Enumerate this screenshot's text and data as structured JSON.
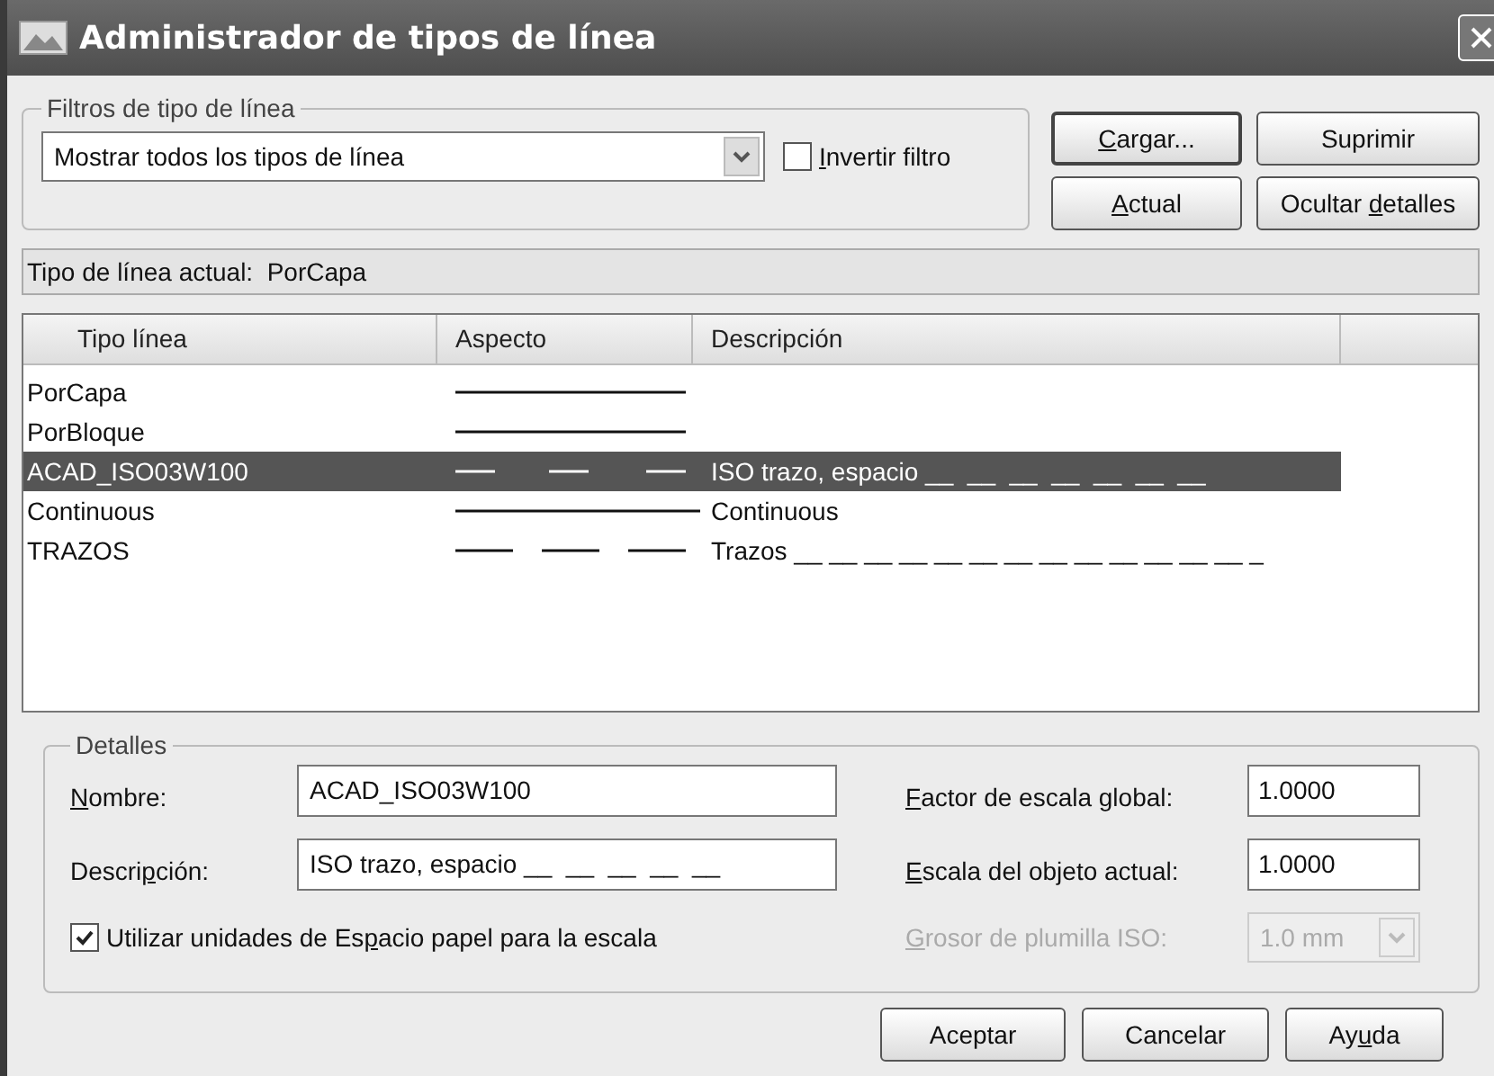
{
  "window": {
    "title": "Administrador de tipos de línea"
  },
  "filter_group": {
    "legend": "Filtros de tipo de línea",
    "dropdown": {
      "value": "Mostrar todos los tipos de línea"
    },
    "invert": {
      "label": [
        {
          "text": "I",
          "underlined": true
        },
        {
          "text": "nvertir filtro",
          "underlined": false
        }
      ],
      "checked": false
    }
  },
  "buttons": [
    {
      "label": [
        {
          "text": "C",
          "underlined": true
        },
        {
          "text": "argar...",
          "underlined": false
        }
      ],
      "default": true
    },
    {
      "label": [
        {
          "text": "Suprimir",
          "underlined": false
        }
      ],
      "default": false
    },
    {
      "label": [
        {
          "text": "A",
          "underlined": true
        },
        {
          "text": "ctual",
          "underlined": false
        }
      ],
      "default": false
    },
    {
      "label": [
        {
          "text": "Ocultar ",
          "underlined": false
        },
        {
          "text": "d",
          "underlined": true
        },
        {
          "text": "etalles",
          "underlined": false
        }
      ],
      "default": false
    }
  ],
  "current_linetype": "Tipo de línea actual:  PorCapa",
  "table": {
    "columns": [
      "Tipo línea",
      "Aspecto",
      "Descripción"
    ],
    "rows": [
      {
        "name": "PorCapa",
        "kind": "solid",
        "selected": false
      },
      {
        "name": "PorBloque",
        "kind": "solid",
        "selected": false
      },
      {
        "name": "ACAD_ISO03W100",
        "kind": "dash-space",
        "description": "ISO trazo, espacio __  __  __  __  __  __  __",
        "selected": true
      },
      {
        "name": "Continuous",
        "kind": "continuous",
        "description": "Continuous",
        "selected": false
      },
      {
        "name": "TRAZOS",
        "kind": "dashes",
        "description": "Trazos __ __ __ __ __ __ __ __ __ __ __ __ __ _",
        "selected": false
      }
    ]
  },
  "details": {
    "legend": "Detalles",
    "fields": [
      {
        "label": [
          {
            "text": "N",
            "underlined": true
          },
          {
            "text": "ombre:",
            "underlined": false
          }
        ],
        "value": "ACAD_ISO03W100"
      },
      {
        "label": [
          {
            "text": "Descri",
            "underlined": false
          },
          {
            "text": "p",
            "underlined": true
          },
          {
            "text": "ción:",
            "underlined": false
          }
        ],
        "value": "ISO trazo, espacio __  __  __  __  __"
      }
    ],
    "scale_fields": [
      {
        "label": [
          {
            "text": "F",
            "underlined": true
          },
          {
            "text": "actor de escala global:",
            "underlined": false
          }
        ],
        "value": "1.0000"
      },
      {
        "label": [
          {
            "text": "E",
            "underlined": true
          },
          {
            "text": "scala del objeto actual:",
            "underlined": false
          }
        ],
        "value": "1.0000"
      }
    ],
    "paper_space": {
      "label": [
        {
          "text": "Utilizar unidades de Es",
          "underlined": false
        },
        {
          "text": "p",
          "underlined": true
        },
        {
          "text": "acio papel para la escala",
          "underlined": false
        }
      ],
      "checked": true
    },
    "pen_width": {
      "label": [
        {
          "text": "G",
          "underlined": true
        },
        {
          "text": "rosor de plumilla ISO:",
          "underlined": false
        }
      ],
      "value": "1.0 mm",
      "disabled": true
    }
  },
  "dialog_buttons": [
    {
      "label": [
        {
          "text": "Aceptar",
          "underlined": false
        }
      ]
    },
    {
      "label": [
        {
          "text": "Cancelar",
          "underlined": false
        }
      ]
    },
    {
      "label": [
        {
          "text": "Ay",
          "underlined": false
        },
        {
          "text": "u",
          "underlined": true
        },
        {
          "text": "da",
          "underlined": false
        }
      ]
    }
  ]
}
